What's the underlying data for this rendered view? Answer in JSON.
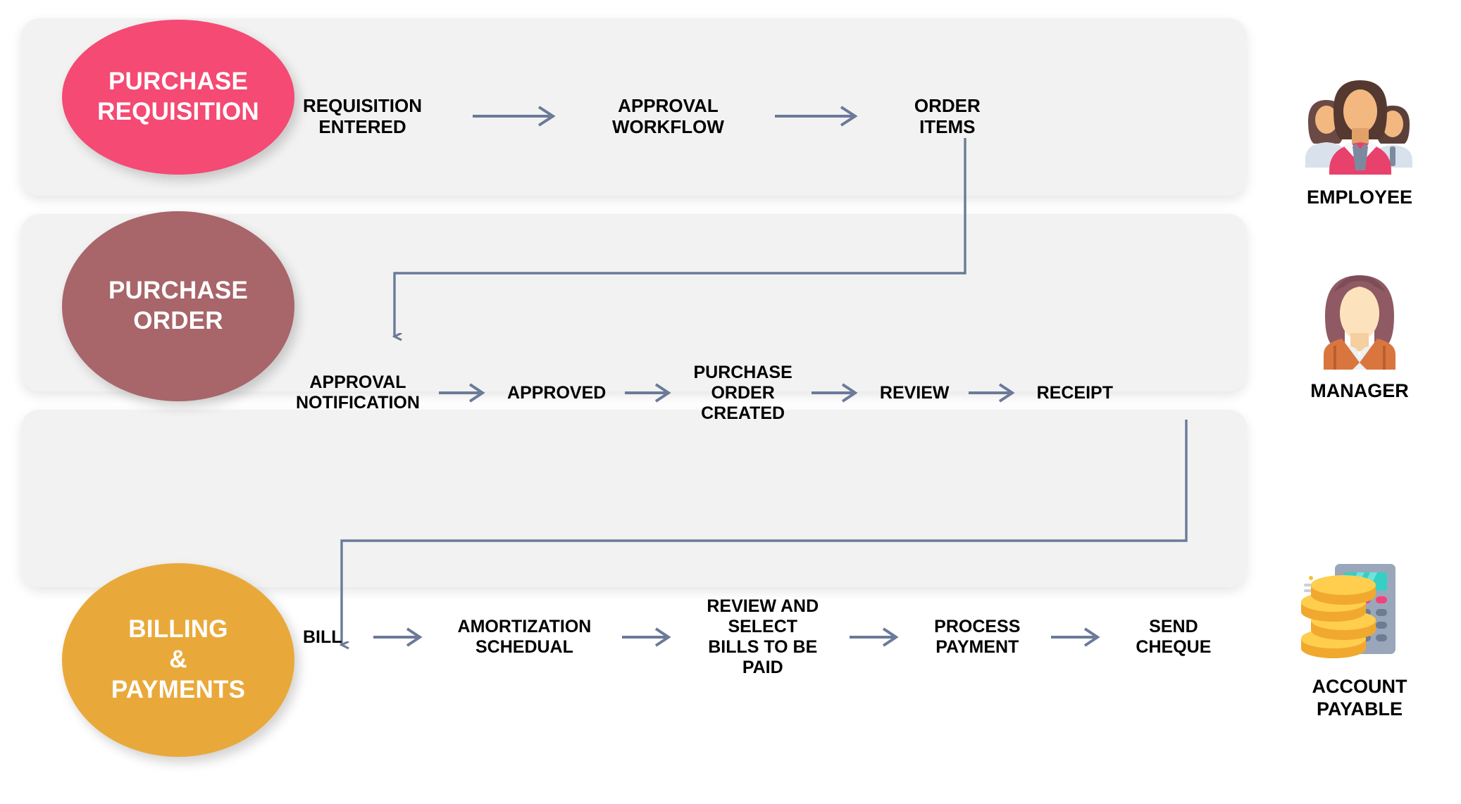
{
  "colors": {
    "panel_bg": "#f2f2f2",
    "page_bg": "#ffffff",
    "requisition_circle": "#f44a73",
    "order_circle": "#a8656a",
    "billing_circle": "#e9a93a",
    "arrow": "#6b7a99",
    "step_text": "#000000"
  },
  "rows": [
    {
      "id": "requisition",
      "circle_lines": [
        "PURCHASE",
        "REQUISITION"
      ],
      "steps": [
        "REQUISITION\nENTERED",
        "APPROVAL\nWORKFLOW",
        "ORDER\nITEMS"
      ]
    },
    {
      "id": "order",
      "circle_lines": [
        "PURCHASE",
        "ORDER"
      ],
      "steps": [
        "APPROVAL\nNOTIFICATION",
        "APPROVED",
        "PURCHASE\nORDER\nCREATED",
        "REVIEW",
        "RECEIPT"
      ]
    },
    {
      "id": "billing",
      "circle_lines": [
        "BILLING",
        "&",
        "PAYMENTS"
      ],
      "steps": [
        "BILL",
        "AMORTIZATION\nSCHEDUAL",
        "REVIEW AND\nSELECT\nBILLS TO BE\nPAID",
        "PROCESS\nPAYMENT",
        "SEND\nCHEQUE"
      ]
    }
  ],
  "personas": [
    {
      "id": "employee",
      "label": "EMPLOYEE",
      "icon": "people-group-icon"
    },
    {
      "id": "manager",
      "label": "MANAGER",
      "icon": "businesswoman-icon"
    },
    {
      "id": "account-payable",
      "label": "ACCOUNT\nPAYABLE",
      "icon": "calculator-coins-icon"
    }
  ],
  "connectors": [
    {
      "id": "order-items-to-approval-notification",
      "from": "ORDER ITEMS",
      "to": "APPROVAL NOTIFICATION"
    },
    {
      "id": "receipt-to-bill",
      "from": "RECEIPT",
      "to": "BILL"
    }
  ]
}
